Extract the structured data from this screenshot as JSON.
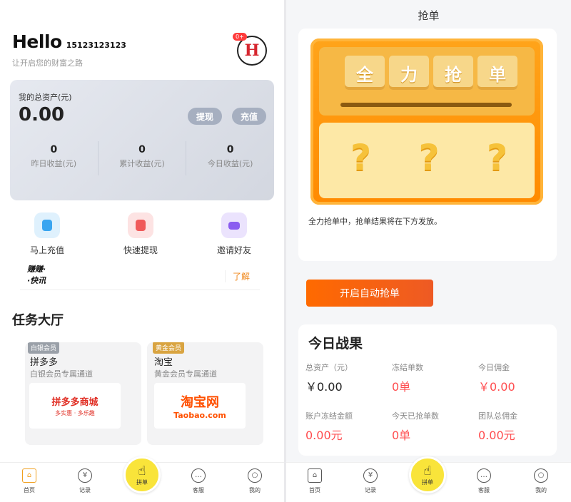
{
  "left": {
    "greeting": "Hello",
    "phone": "15123123123",
    "subtitle": "让开启您的财富之路",
    "avatar_text": "H",
    "avatar_badge": "0+",
    "asset": {
      "label": "我的总资产(元)",
      "amount": "0.00",
      "withdraw_label": "提现",
      "recharge_label": "充值",
      "stats": [
        {
          "value": "0",
          "label": "昨日收益(元)"
        },
        {
          "value": "0",
          "label": "累计收益(元)"
        },
        {
          "value": "0",
          "label": "今日收益(元)"
        }
      ]
    },
    "quick_actions": [
      {
        "label": "马上充值",
        "icon": "person-icon",
        "color": "#3aa5f0"
      },
      {
        "label": "快速提现",
        "icon": "bookmark-icon",
        "color": "#f05a5a"
      },
      {
        "label": "邀请好友",
        "icon": "wallet-icon",
        "color": "#8a5cf0"
      }
    ],
    "news": {
      "logo_line1": "赚赚·",
      "logo_line2": "·快讯",
      "more": "了解"
    },
    "section_title": "任务大厅",
    "tasks": [
      {
        "tag": "白银会员",
        "tag_color": "#9aa0a8",
        "name": "拼多多",
        "desc": "白银会员专属通道",
        "logo_main": "拼多多商城",
        "logo_sub": "多实惠 · 多乐趣",
        "logo_color": "#e02e24"
      },
      {
        "tag": "黄金会员",
        "tag_color": "#d9a441",
        "name": "淘宝",
        "desc": "黄金会员专属通道",
        "logo_main": "淘宝网",
        "logo_sub": "Taobao.com",
        "logo_color": "#ff5000"
      }
    ],
    "tabs": [
      "首页",
      "记录",
      "拼单",
      "客服",
      "我的"
    ]
  },
  "right": {
    "header_title": "抢单",
    "machine_chars": [
      "全",
      "力",
      "抢",
      "单"
    ],
    "machine_q": [
      "?",
      "?",
      "?"
    ],
    "tip": "全力抢单中，抢单结果将在下方发放。",
    "auto_button": "开启自动抢单",
    "today": {
      "title": "今日战果",
      "cells": [
        {
          "label": "总资产（元）",
          "value": "￥0.00",
          "style": "dark"
        },
        {
          "label": "冻结单数",
          "value": "0单",
          "style": "red"
        },
        {
          "label": "今日佣金",
          "value": "￥0.00",
          "style": "red"
        },
        {
          "label": "账户冻结金额",
          "value": "0.00元",
          "style": "red"
        },
        {
          "label": "今天已抢单数",
          "value": "0单",
          "style": "red"
        },
        {
          "label": "团队总佣金",
          "value": "0.00元",
          "style": "red"
        }
      ]
    },
    "tabs": [
      "首页",
      "记录",
      "拼单",
      "客服",
      "我的"
    ]
  }
}
